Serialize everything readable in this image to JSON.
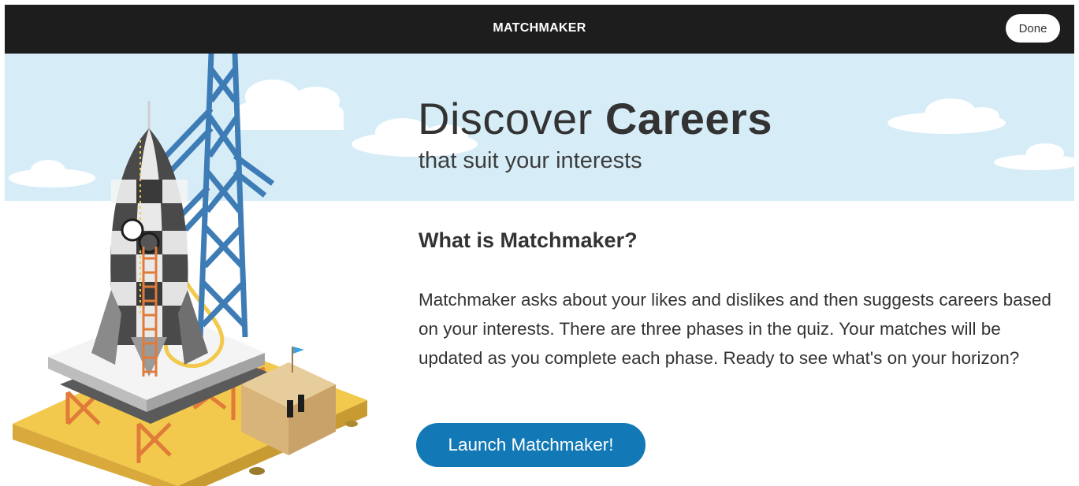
{
  "topbar": {
    "title": "MATCHMAKER",
    "done_label": "Done"
  },
  "hero": {
    "headline_light": "Discover ",
    "headline_bold": "Careers",
    "subheadline": "that suit your interests"
  },
  "intro": {
    "title": "What is Matchmaker?",
    "body": "Matchmaker asks about your likes and dislikes and then suggests careers based on your interests. There are three phases in the quiz. Your matches will be updated as you complete each phase. Ready to see what's on your horizon?"
  },
  "cta": {
    "launch_label": "Launch Matchmaker!"
  },
  "colors": {
    "topbar": "#1d1d1d",
    "sky": "#d6edf8",
    "accent": "#1279b6",
    "tower": "#3e7cb6",
    "sand": "#f2c94c"
  },
  "icons": {
    "illustration": "rocket-launchpad-illustration",
    "flag": "flag-icon"
  }
}
